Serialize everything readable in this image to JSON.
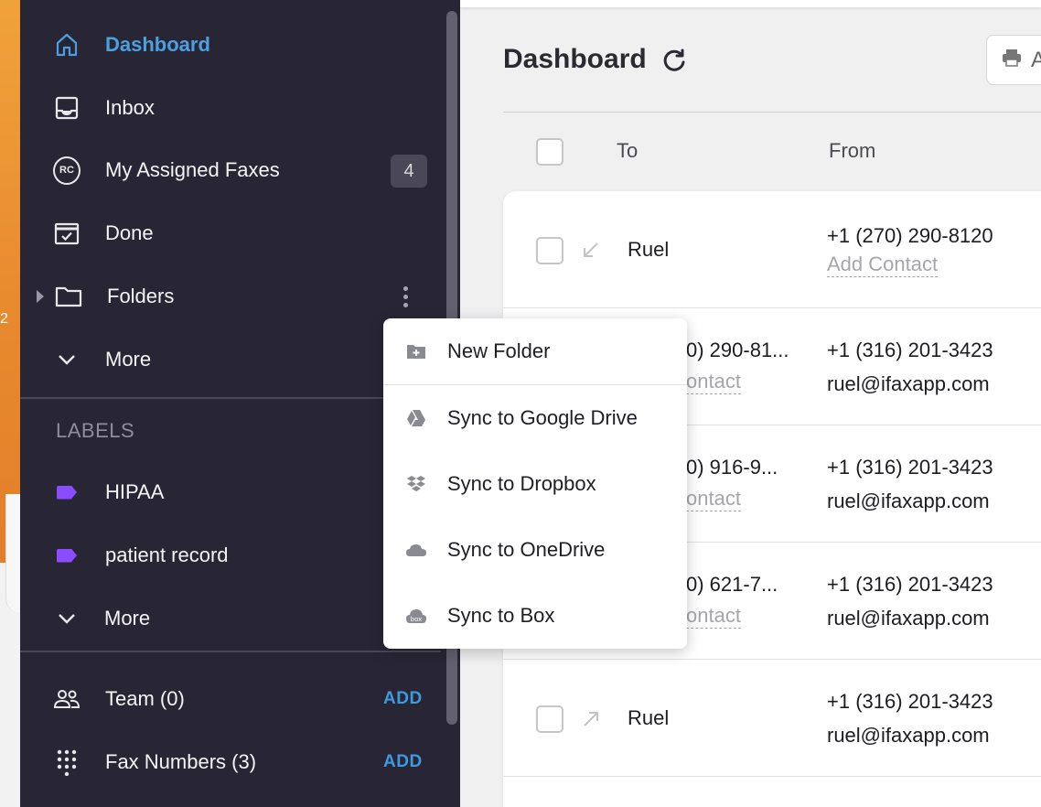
{
  "desktop": {
    "edge_glyph": "2"
  },
  "sidebar": {
    "nav": [
      {
        "label": "Dashboard",
        "icon": "home-icon",
        "active": true
      },
      {
        "label": "Inbox",
        "icon": "inbox-icon"
      },
      {
        "label": "My Assigned Faxes",
        "icon": "rc-icon",
        "icon_text": "RC",
        "count": "4"
      },
      {
        "label": "Done",
        "icon": "calendar-check-icon"
      },
      {
        "label": "Folders",
        "icon": "folder-icon"
      },
      {
        "label": "More",
        "icon": "chevron-down-icon"
      }
    ],
    "labels_title": "LABELS",
    "labels": [
      {
        "label": "HIPAA",
        "icon": "label-tag-icon",
        "color": "#8b4bff"
      },
      {
        "label": "patient record",
        "icon": "label-tag-icon",
        "color": "#8b4bff"
      }
    ],
    "labels_more": "More",
    "team": {
      "label": "Team (0)",
      "action": "ADD"
    },
    "fax_numbers": {
      "label": "Fax Numbers (3)",
      "action": "ADD"
    }
  },
  "folder_menu": {
    "items": [
      {
        "label": "New Folder",
        "icon": "new-folder-icon"
      },
      {
        "label": "Sync to Google Drive",
        "icon": "google-drive-icon"
      },
      {
        "label": "Sync to Dropbox",
        "icon": "dropbox-icon"
      },
      {
        "label": "Sync to OneDrive",
        "icon": "onedrive-icon"
      },
      {
        "label": "Sync to Box",
        "icon": "box-icon"
      }
    ]
  },
  "main": {
    "title": "Dashboard",
    "action_button_partial": "A",
    "columns": {
      "to": "To",
      "from": "From"
    },
    "rows": [
      {
        "direction": "incoming",
        "to_name": "Ruel",
        "from_number": "+1 (270) 290-8120",
        "from_sub": "Add Contact",
        "from_sub_is_link": true
      },
      {
        "to_number": "0) 290-81...",
        "to_contact": "ontact",
        "from_number": "+1 (316) 201-3423",
        "from_sub": "ruel@ifaxapp.com"
      },
      {
        "to_number": "0) 916-9...",
        "to_contact": "ontact",
        "from_number": "+1 (316) 201-3423",
        "from_sub": "ruel@ifaxapp.com"
      },
      {
        "to_number": "0) 621-7...",
        "to_contact": "ontact",
        "from_number": "+1 (316) 201-3423",
        "from_sub": "ruel@ifaxapp.com"
      },
      {
        "direction": "outgoing",
        "to_name": "Ruel",
        "from_number": "+1 (316) 201-3423",
        "from_sub": "ruel@ifaxapp.com"
      }
    ]
  },
  "colors": {
    "sidebar_bg": "#282634",
    "accent": "#4da0e0",
    "label_purple": "#8b4bff"
  }
}
